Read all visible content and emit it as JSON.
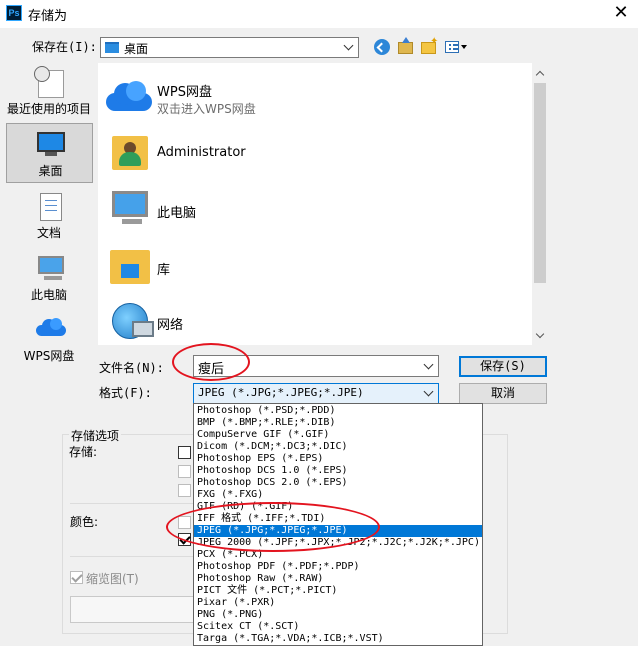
{
  "window": {
    "app_icon_text": "Ps",
    "title": "存储为",
    "close_glyph": "✕"
  },
  "toolbar": {
    "save_in_label": "保存在(I):",
    "save_in_value": "桌面"
  },
  "places": [
    {
      "label": "最近使用的项目",
      "icon": "recent-items-icon"
    },
    {
      "label": "桌面",
      "icon": "desktop-icon",
      "selected": true
    },
    {
      "label": "文档",
      "icon": "documents-icon"
    },
    {
      "label": "此电脑",
      "icon": "this-pc-icon"
    },
    {
      "label": "WPS网盘",
      "icon": "wps-cloud-icon"
    }
  ],
  "files": [
    {
      "name": "WPS网盘",
      "sub": "双击进入WPS网盘",
      "icon": "wps-cloud-icon"
    },
    {
      "name": "Administrator",
      "sub": "",
      "icon": "user-folder-icon"
    },
    {
      "name": "此电脑",
      "sub": "",
      "icon": "computer-icon"
    },
    {
      "name": "库",
      "sub": "",
      "icon": "library-icon"
    },
    {
      "name": "网络",
      "sub": "",
      "icon": "network-icon"
    }
  ],
  "form": {
    "filename_label": "文件名(N):",
    "filename_value": "瘦后",
    "format_label": "格式(F):",
    "format_value": "JPEG (*.JPG;*.JPEG;*.JPE)",
    "save_button": "保存(S)",
    "cancel_button": "取消"
  },
  "options": {
    "group_title": "存储选项",
    "store_label": "存储:",
    "color_label": "颜色:",
    "thumbnail_label": "缩览图(T)",
    "thumbnail_checked": true
  },
  "format_options": [
    "Photoshop (*.PSD;*.PDD)",
    "BMP (*.BMP;*.RLE;*.DIB)",
    "CompuServe GIF (*.GIF)",
    "Dicom (*.DCM;*.DC3;*.DIC)",
    "Photoshop EPS (*.EPS)",
    "Photoshop DCS 1.0 (*.EPS)",
    "Photoshop DCS 2.0 (*.EPS)",
    "FXG (*.FXG)",
    "GIF (RD) (*.GIF)",
    "IFF 格式 (*.IFF;*.TDI)",
    "JPEG (*.JPG;*.JPEG;*.JPE)",
    "JPEG 2000 (*.JPF;*.JPX;*.JP2;*.J2C;*.J2K;*.JPC)",
    "PCX (*.PCX)",
    "Photoshop PDF (*.PDF;*.PDP)",
    "Photoshop Raw (*.RAW)",
    "PICT 文件 (*.PCT;*.PICT)",
    "Pixar (*.PXR)",
    "PNG (*.PNG)",
    "Scitex CT (*.SCT)",
    "Targa (*.TGA;*.VDA;*.ICB;*.VST)"
  ],
  "selected_format_index": 10,
  "colors": {
    "selection": "#0078d7",
    "annotation": "#e3141f"
  }
}
